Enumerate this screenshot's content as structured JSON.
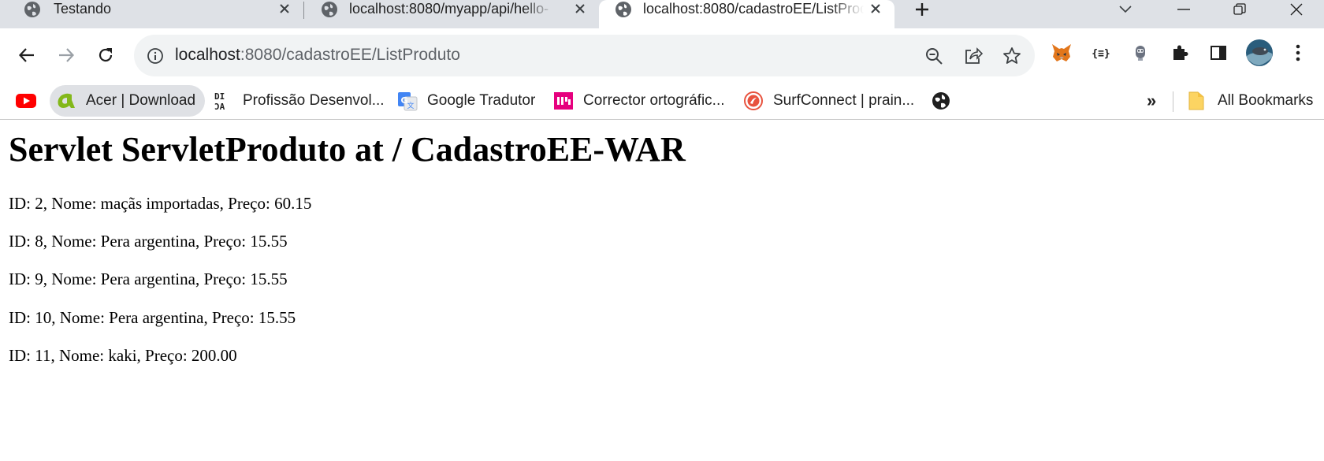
{
  "tabs": [
    {
      "title": "Testando"
    },
    {
      "title": "localhost:8080/myapp/api/hello-"
    },
    {
      "title": "localhost:8080/cadastroEE/ListProduto"
    }
  ],
  "address_bar": {
    "host": "localhost",
    "path": ":8080/cadastroEE/ListProduto"
  },
  "bookmarks": [
    {
      "label": "",
      "icon": "youtube-icon"
    },
    {
      "label": "Acer | Download",
      "icon": "acer-icon"
    },
    {
      "label": "Profissão Desenvol...",
      "icon": "dio-icon"
    },
    {
      "label": "Google Tradutor",
      "icon": "google-translate-icon"
    },
    {
      "label": "Corrector ortográfic...",
      "icon": "corrector-icon"
    },
    {
      "label": "SurfConnect | prain...",
      "icon": "surfconnect-icon"
    },
    {
      "label": "",
      "icon": "globe-icon"
    }
  ],
  "overflow_label": "»",
  "all_bookmarks_label": "All Bookmarks",
  "page": {
    "heading": "Servlet ServletProduto at / CadastroEE-WAR",
    "products": [
      "ID: 2, Nome: maçãs importadas, Preço: 60.15",
      "ID: 8, Nome: Pera argentina, Preço: 15.55",
      "ID: 9, Nome: Pera argentina, Preço: 15.55",
      "ID: 10, Nome: Pera argentina, Preço: 15.55",
      "ID: 11, Nome: kaki, Preço: 200.00"
    ]
  },
  "colors": {
    "tabstrip_bg": "#dee1e6",
    "omnibox_bg": "#f1f3f4",
    "youtube_red": "#ff0000",
    "acer_green": "#83b81a"
  }
}
